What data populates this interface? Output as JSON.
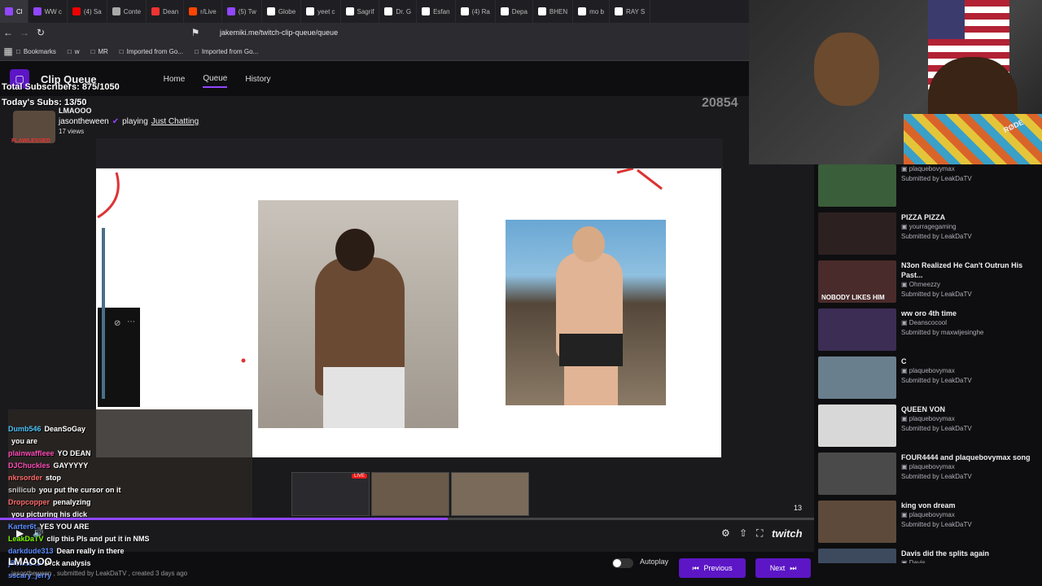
{
  "browser": {
    "tabs": [
      {
        "label": "Cl",
        "color": "#9147ff",
        "active": true
      },
      {
        "label": "WW c",
        "color": "#9147ff"
      },
      {
        "label": "(4) Sa",
        "color": "#e00"
      },
      {
        "label": "Conte",
        "color": "#aaa"
      },
      {
        "label": "Dean",
        "color": "#e33"
      },
      {
        "label": "r/Live",
        "color": "#ff4500"
      },
      {
        "label": "(5) Tw",
        "color": "#9147ff"
      },
      {
        "label": "Globe",
        "color": "#fff"
      },
      {
        "label": "yeet c",
        "color": "#fff"
      },
      {
        "label": "Sagrif",
        "color": "#fff"
      },
      {
        "label": "Dr. G",
        "color": "#fff"
      },
      {
        "label": "Esfan",
        "color": "#fff"
      },
      {
        "label": "(4) Ra",
        "color": "#fff"
      },
      {
        "label": "Depa",
        "color": "#fff"
      },
      {
        "label": "BHEN",
        "color": "#fff"
      },
      {
        "label": "mo b",
        "color": "#fff"
      },
      {
        "label": "RAY S",
        "color": "#fff"
      }
    ],
    "url": "jakemiki.me/twitch-clip-queue/queue",
    "bookmarks": [
      {
        "label": "Bookmarks"
      },
      {
        "label": "w"
      },
      {
        "label": "MR"
      },
      {
        "label": "Imported from Go..."
      },
      {
        "label": "Imported from Go..."
      }
    ]
  },
  "app": {
    "title": "Clip Queue",
    "nav": [
      {
        "label": "Home",
        "active": false
      },
      {
        "label": "Queue",
        "active": true
      },
      {
        "label": "History",
        "active": false
      }
    ]
  },
  "overlay": {
    "total_subs": "Total Subscribers: 875/1050",
    "todays_subs": "Today's Subs: 13/50",
    "lmaooo_top": "LMAOOO",
    "counter": "20854",
    "clip_channel": "jasontheween",
    "clip_playing": "playing",
    "clip_game": "Just Chatting",
    "clip_views": "17 views",
    "flawless": "FLAWLESSED",
    "lmaooo_bottom": "LMAOOO"
  },
  "chat": [
    {
      "user": "Dumb546",
      "msg": "DeanSoGay",
      "color": "#4fc3f7"
    },
    {
      "user": "",
      "msg": "you are",
      "color": "#4fc3f7"
    },
    {
      "user": "plainwaffleee",
      "msg": "YO DEAN",
      "color": "#ff4db8"
    },
    {
      "user": "DJChuckles",
      "msg": "GAYYYYY",
      "color": "#ff4db8"
    },
    {
      "user": "nkrsorder",
      "msg": "stop",
      "color": "#ff6b6b"
    },
    {
      "user": "snilicub",
      "msg": "you put the cursor on it",
      "color": "#ccc"
    },
    {
      "user": "Dropcopper",
      "msg": "penalyzing",
      "color": "#ff6b6b"
    },
    {
      "user": "",
      "msg": "you picturing his dick",
      "color": "#ff6b6b"
    },
    {
      "user": "Karter6t",
      "msg": "YES YOU ARE",
      "color": "#5b8cff"
    },
    {
      "user": "LeakDaTV",
      "msg": "clip this Pls and put it in NMS",
      "color": "#7CFC00"
    },
    {
      "user": "darkdude313",
      "msg": "Dean really in there",
      "color": "#5b8cff"
    },
    {
      "user": "jBenito23",
      "msg": "Dick analysis",
      "color": "#5b8cff"
    },
    {
      "user": "sscary_jerry",
      "msg": "",
      "color": "#5b8cff"
    }
  ],
  "player": {
    "counter": "13",
    "brand": "twitch",
    "clip_footer": "jasontheween , submitted by LeakDaTV , created 3 days ago",
    "live_badge": "LIVE",
    "progress": 0.55
  },
  "controls": {
    "autoplay_label": "Autoplay",
    "prev_label": "Previous",
    "next_label": "Next"
  },
  "queue": [
    {
      "title": "",
      "channel": "plaquebovymax",
      "submitted": "Submitted by LeakDaTV",
      "thumb": "#3a5e3a",
      "label": ""
    },
    {
      "title": "PIZZA PIZZA",
      "channel": "yourragegaming",
      "submitted": "Submitted by LeakDaTV",
      "thumb": "#2d2020",
      "label": ""
    },
    {
      "title": "N3on Realized He Can't Outrun His Past...",
      "channel": "Ohmeezzy",
      "submitted": "Submitted by LeakDaTV",
      "thumb": "#4a2b2b",
      "label": "NOBODY LIKES HIM"
    },
    {
      "title": "ww oro 4th time",
      "channel": "Deanscocool",
      "submitted": "Submitted by maxwijesinghe",
      "thumb": "#3c2d55",
      "label": ""
    },
    {
      "title": "C",
      "channel": "plaquebovymax",
      "submitted": "Submitted by LeakDaTV",
      "thumb": "#6a7f8e",
      "label": ""
    },
    {
      "title": "QUEEN VON",
      "channel": "plaquebovymax",
      "submitted": "Submitted by LeakDaTV",
      "thumb": "#d8d8d8",
      "label": ""
    },
    {
      "title": "FOUR4444 and plaquebovymax song",
      "channel": "plaquebovymax",
      "submitted": "Submitted by LeakDaTV",
      "thumb": "#4a4a4a",
      "label": ""
    },
    {
      "title": "king von dream",
      "channel": "plaquebovymax",
      "submitted": "Submitted by LeakDaTV",
      "thumb": "#5e4a3a",
      "label": ""
    },
    {
      "title": "Davis did the splits again",
      "channel": "Davis",
      "submitted": "",
      "thumb": "#3d4a5e",
      "label": ""
    }
  ]
}
